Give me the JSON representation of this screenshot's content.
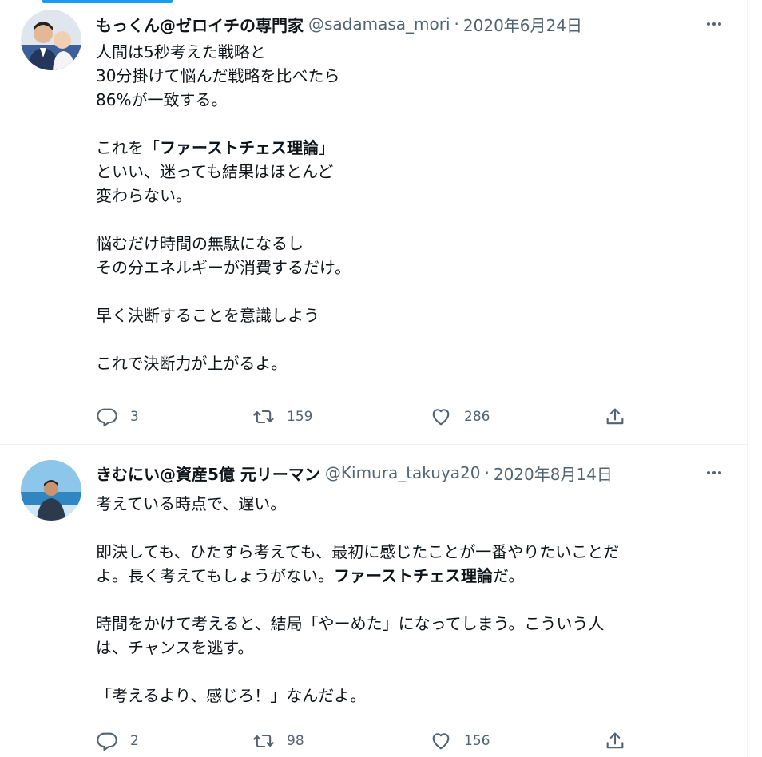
{
  "tweets": [
    {
      "display_name": "もっくん@ゼロイチの専門家",
      "handle": "@sadamasa_mori",
      "separator": "·",
      "date": "2020年6月24日",
      "avatar_icon": "avatar-man-holding-baby",
      "lines": [
        "人間は5秒考えた戦略と",
        "30分掛けて悩んだ戦略を比べたら",
        "86%が一致する。",
        "",
        {
          "pre": "これを「",
          "bold": "ファーストチェス理論",
          "post": "」"
        },
        "といい、迷っても結果はほとんど",
        "変わらない。",
        "",
        "悩むだけ時間の無駄になるし",
        "その分エネルギーが消費するだけ。",
        "",
        "早く決断することを意識しよう",
        "",
        "これで決断力が上がるよ。"
      ],
      "stats": {
        "replies": "3",
        "retweets": "159",
        "likes": "286"
      }
    },
    {
      "display_name": "きむにい@資産5億 元リーマン",
      "handle": "@Kimura_takuya20",
      "separator": "·",
      "date": "2020年8月14日",
      "avatar_icon": "avatar-man-at-beach",
      "lines": [
        "考えている時点で、遅い。",
        "",
        "即決しても、ひたすら考えても、最初に感じたことが一番やりたいことだ",
        {
          "pre": "よ。長く考えてもしょうがない。",
          "bold": "ファーストチェス理論",
          "post": "だ。"
        },
        "",
        "時間をかけて考えると、結局「やーめた」になってしまう。こういう人",
        "は、チャンスを逃す。",
        "",
        "「考えるより、感じろ！」なんだよ。"
      ],
      "stats": {
        "replies": "2",
        "retweets": "98",
        "likes": "156"
      }
    }
  ],
  "icons": {
    "more": "more-dots-icon",
    "reply": "reply-icon",
    "retweet": "retweet-icon",
    "like": "like-icon",
    "share": "share-icon"
  },
  "colors": {
    "accent": "#1d9bf0",
    "text": "#0f1419",
    "secondary": "#536471",
    "divider": "#eff3f4"
  }
}
